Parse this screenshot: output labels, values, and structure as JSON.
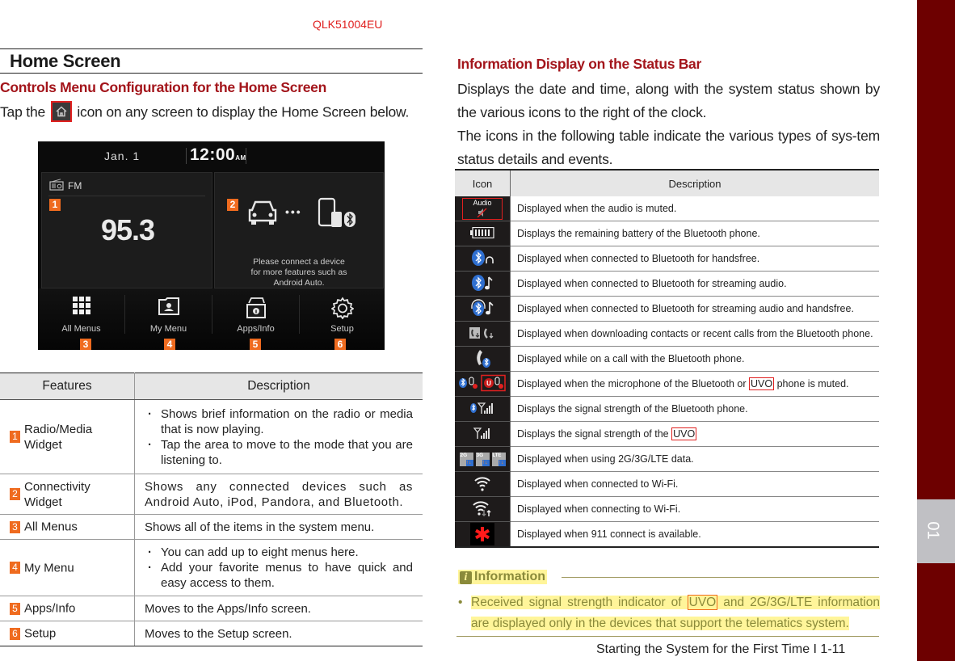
{
  "header": {
    "doc_code": "QLK51004EU"
  },
  "left": {
    "section_title": "Home Screen",
    "subsection_title": "Controls Menu Configuration for the Home Screen",
    "intro_before": "Tap the",
    "intro_after": "icon on any screen to display the Home Screen below.",
    "intro_icon": "home-icon",
    "head_unit": {
      "date": "Jan.  1",
      "time": "12:00",
      "ampm": "AM",
      "radio_source": "FM",
      "frequency": "95.3",
      "connect_message": [
        "Please connect a device",
        "for more features such as",
        "Android Auto."
      ],
      "buttons": [
        {
          "label": "All Menus",
          "icon": "grid-icon",
          "badge": "3"
        },
        {
          "label": "My Menu",
          "icon": "folder-person-icon",
          "badge": "4"
        },
        {
          "label": "Apps/Info",
          "icon": "apps-info-icon",
          "badge": "5"
        },
        {
          "label": "Setup",
          "icon": "gear-icon",
          "badge": "6"
        }
      ],
      "widget_badges": [
        "1",
        "2"
      ]
    },
    "features_table": {
      "headers": [
        "Features",
        "Description"
      ],
      "rows": [
        {
          "num": "1",
          "feature": "Radio/Media Widget",
          "bullets": [
            "Shows brief information on the radio or media that is now playing.",
            "Tap the area to move to the mode that you are listening to."
          ]
        },
        {
          "num": "2",
          "feature": "Connectivity Widget",
          "text": "Shows any connected devices such as Android Auto, iPod, Pandora, and Bluetooth."
        },
        {
          "num": "3",
          "feature": "All Menus",
          "text": "Shows all of the items in the system menu."
        },
        {
          "num": "4",
          "feature": "My Menu",
          "bullets": [
            "You can add up to eight menus here.",
            "Add your favorite menus to have quick and easy access to them."
          ]
        },
        {
          "num": "5",
          "feature": "Apps/Info",
          "text": "Moves to the Apps/Info screen."
        },
        {
          "num": "6",
          "feature": "Setup",
          "text": "Moves to the Setup screen."
        }
      ]
    }
  },
  "right": {
    "section_title": "Information Display on the Status Bar",
    "para1": "Displays the date and time, along with the system status shown by the various icons to the right of the clock.",
    "para2": "The icons in the following table indicate the various types of sys-tem status details and events.",
    "icon_table": {
      "headers": [
        "Icon",
        "Description"
      ],
      "rows": [
        {
          "icon": "audio-muted-icon",
          "icon_text": "Audio",
          "desc": "Displayed when the audio is muted."
        },
        {
          "icon": "phone-battery-icon",
          "desc": "Displays the remaining battery of the Bluetooth phone."
        },
        {
          "icon": "bluetooth-handsfree-icon",
          "desc": "Displayed when connected to Bluetooth for handsfree."
        },
        {
          "icon": "bluetooth-audio-icon",
          "desc": "Displayed when connected to Bluetooth for streaming audio."
        },
        {
          "icon": "bluetooth-audio-handsfree-icon",
          "desc": "Displayed when connected to Bluetooth for streaming audio and handsfree."
        },
        {
          "icon": "download-contacts-icon",
          "desc": "Displayed when downloading contacts or recent calls from the Bluetooth phone."
        },
        {
          "icon": "bluetooth-call-icon",
          "desc": "Displayed while on a call with the Bluetooth phone."
        },
        {
          "icon": "mic-muted-icon",
          "desc_before": "Displayed when the microphone of the Bluetooth or",
          "desc_uvo": "UVO",
          "desc_after": "phone is muted."
        },
        {
          "icon": "bluetooth-signal-icon",
          "desc": "Displays the signal strength of the Bluetooth phone."
        },
        {
          "icon": "uvo-signal-icon",
          "desc_before": "Displays the signal strength of the",
          "desc_uvo": "UVO",
          "desc_after": ""
        },
        {
          "icon": "data-2g-3g-lte-icon",
          "icon_labels": [
            "2G",
            "3G",
            "LTE"
          ],
          "desc": "Displayed when using 2G/3G/LTE data."
        },
        {
          "icon": "wifi-connected-icon",
          "desc": "Displayed when connected to Wi-Fi."
        },
        {
          "icon": "wifi-connecting-icon",
          "desc": "Displayed when connecting to Wi-Fi."
        },
        {
          "icon": "911-connect-icon",
          "desc": "Displayed when 911 connect is available."
        }
      ]
    },
    "information": {
      "title": "Information",
      "text_before": "Received signal strength indicator of",
      "text_uvo": "UVO",
      "text_after": "and 2G/3G/LTE information are displayed only in the devices that support the telematics system."
    }
  },
  "footer": {
    "page_label": "Starting the System for the First Time I 1-11"
  },
  "side_tab": {
    "chapter": "01"
  },
  "colors": {
    "heading_red": "#a3151b",
    "badge_orange": "#ef6b1f",
    "side_maroon": "#6d0000",
    "highlight_yellow": "#fff59a"
  }
}
